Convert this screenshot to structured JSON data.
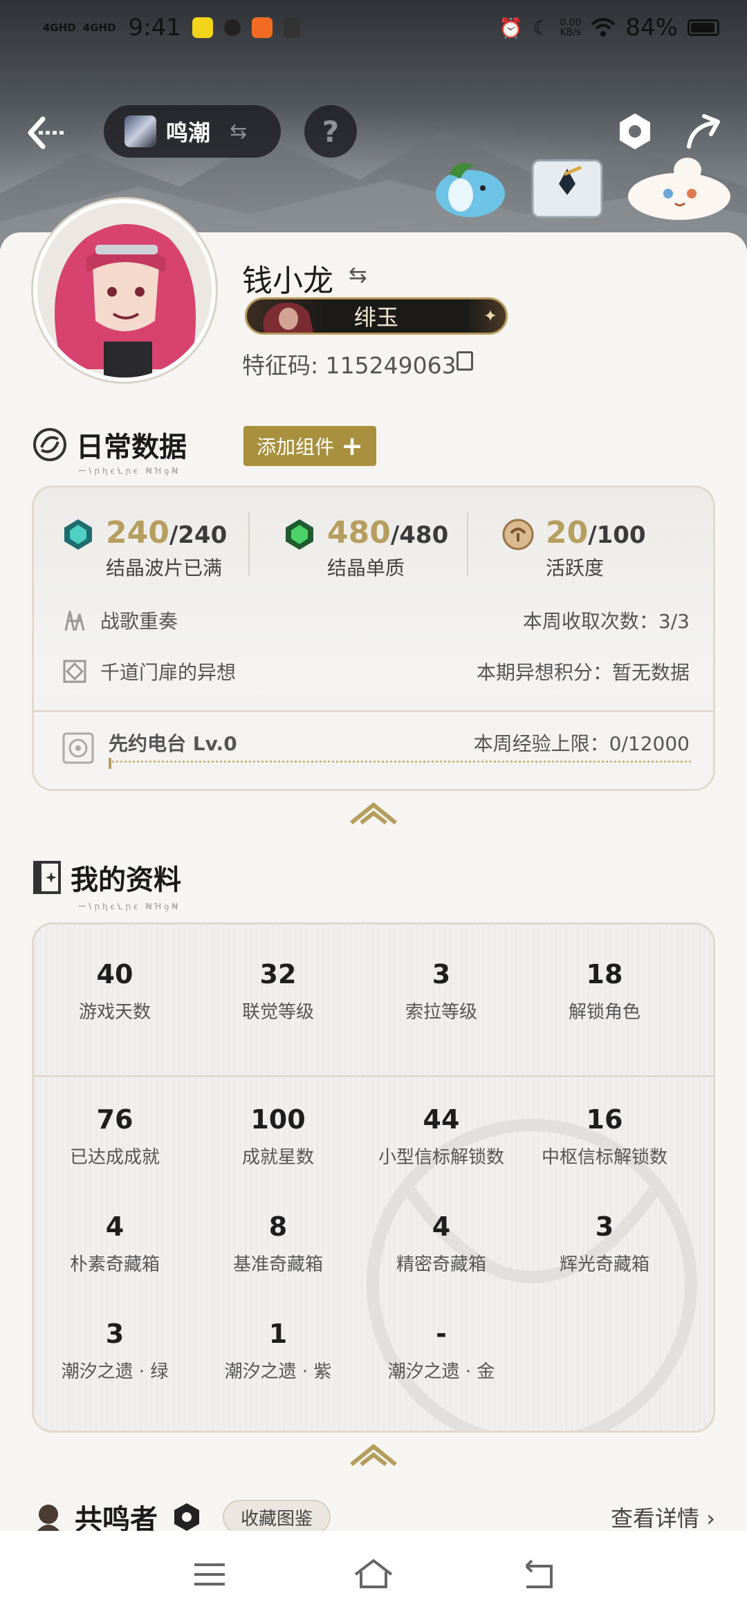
{
  "status_bar": {
    "network": "4GHD",
    "time": "9:41",
    "speed_value": "0.00",
    "speed_unit": "KB/s",
    "battery": "84%"
  },
  "header": {
    "game_name": "鸣潮",
    "help_symbol": "?"
  },
  "profile": {
    "username": "钱小龙",
    "title_badge": "绯玉",
    "uid_label": "特征码: 115249063"
  },
  "daily": {
    "heading": "日常数据",
    "subheading": "ꟷꝇꞃꞕꞓꝆꞃꞓ ꞤꞪꝯꞤ",
    "add_widget": "添加组件",
    "stats": [
      {
        "value": "240",
        "total": "/240",
        "label": "结晶波片已满"
      },
      {
        "value": "480",
        "total": "/480",
        "label": "结晶单质"
      },
      {
        "value": "20",
        "total": "/100",
        "label": "活跃度"
      }
    ],
    "rows": [
      {
        "left": "战歌重奏",
        "right": "本周收取次数：3/3"
      },
      {
        "left": "千道门扉的异想",
        "right": "本期异想积分：暂无数据"
      }
    ],
    "radio": {
      "left": "先约电台 Lv.0",
      "right": "本周经验上限：0/12000",
      "progress": 0
    }
  },
  "my_profile": {
    "heading": "我的资料",
    "subheading": "ꟷꝇꞃꞕꞓꝆꞃꞓ ꞤꞪꝯꞤ",
    "top": [
      {
        "value": "40",
        "label": "游戏天数"
      },
      {
        "value": "32",
        "label": "联觉等级"
      },
      {
        "value": "3",
        "label": "索拉等级"
      },
      {
        "value": "18",
        "label": "解锁角色"
      }
    ],
    "grid": [
      {
        "value": "76",
        "label": "已达成成就"
      },
      {
        "value": "100",
        "label": "成就星数"
      },
      {
        "value": "44",
        "label": "小型信标解锁数"
      },
      {
        "value": "16",
        "label": "中枢信标解锁数"
      },
      {
        "value": "4",
        "label": "朴素奇藏箱"
      },
      {
        "value": "8",
        "label": "基准奇藏箱"
      },
      {
        "value": "4",
        "label": "精密奇藏箱"
      },
      {
        "value": "3",
        "label": "辉光奇藏箱"
      },
      {
        "value": "3",
        "label": "潮汐之遗 · 绿"
      },
      {
        "value": "1",
        "label": "潮汐之遗 · 紫"
      },
      {
        "value": "-",
        "label": "潮汐之遗 · 金"
      }
    ]
  },
  "partners": {
    "heading": "共鸣者",
    "collect": "收藏图鉴",
    "details": "查看详情 ›"
  },
  "colors": {
    "gold": "#b59e5e",
    "button_gold": "#a8903e",
    "card_border": "#e0d9cd"
  }
}
